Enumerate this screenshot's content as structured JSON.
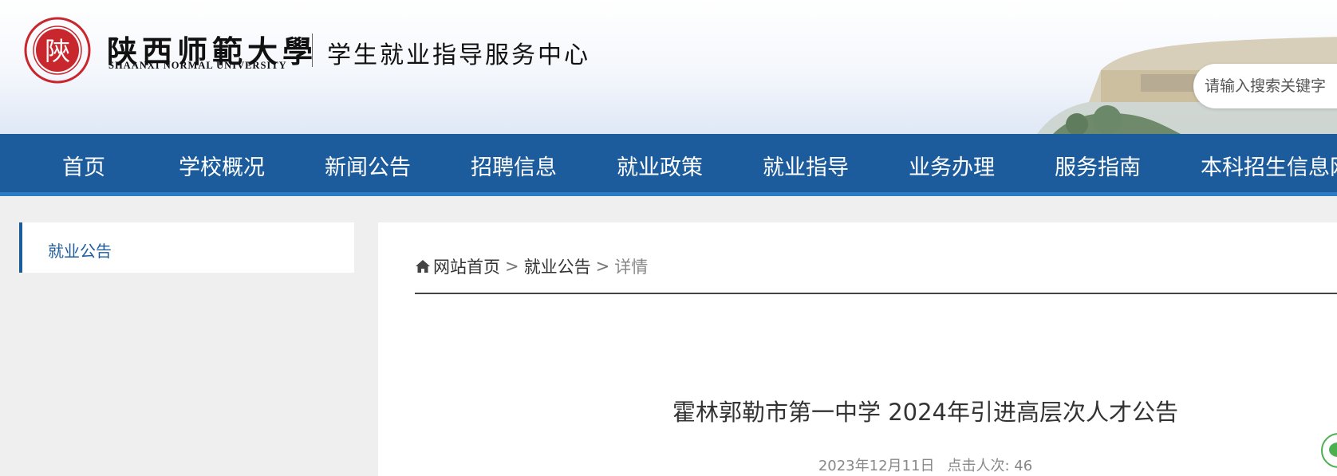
{
  "header": {
    "logo_cn": "陕西师範大學",
    "logo_en": "SHAANXI NORMAL UNIVERSITY",
    "site_title": "学生就业指导服务中心",
    "seal_char": "陝",
    "search_placeholder": "请输入搜索关键字"
  },
  "nav": {
    "items": [
      {
        "label": "首页"
      },
      {
        "label": "学校概况"
      },
      {
        "label": "新闻公告"
      },
      {
        "label": "招聘信息"
      },
      {
        "label": "就业政策"
      },
      {
        "label": "就业指导"
      },
      {
        "label": "业务办理"
      },
      {
        "label": "服务指南"
      },
      {
        "label": "本科招生信息网"
      }
    ]
  },
  "sidebar": {
    "items": [
      {
        "label": "就业公告"
      }
    ]
  },
  "breadcrumb": {
    "home": "网站首页",
    "sep": ">",
    "section": "就业公告",
    "current": "详情"
  },
  "article": {
    "title": "霍林郭勒市第一中学 2024年引进高层次人才公告",
    "date": "2023年12月11日",
    "views_label": "点击人次:",
    "views": "46"
  },
  "colors": {
    "nav_bg": "#1c5c9c",
    "accent": "#1c5c9c",
    "seal": "#c8272d"
  }
}
